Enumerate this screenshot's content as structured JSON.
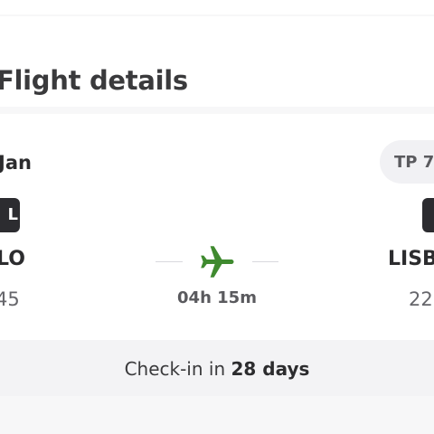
{
  "section": {
    "title": "Flight details"
  },
  "flight": {
    "date_label": "Jan",
    "flight_number": "TP 7",
    "origin": {
      "terminal_badge": "L",
      "airport": "LO",
      "time": "45"
    },
    "destination": {
      "terminal_badge": "",
      "airport": "LISB",
      "time": "22"
    },
    "duration": "04h 15m"
  },
  "checkin": {
    "prefix": "Check-in in",
    "countdown": "28 days"
  },
  "colors": {
    "plane_icon": "#3f8a2f",
    "badge_bg": "#2c2c30",
    "chip_bg": "#f1f1f4",
    "checkin_bg": "#f3f3f5"
  },
  "icons": {
    "route": "airplane-icon"
  }
}
